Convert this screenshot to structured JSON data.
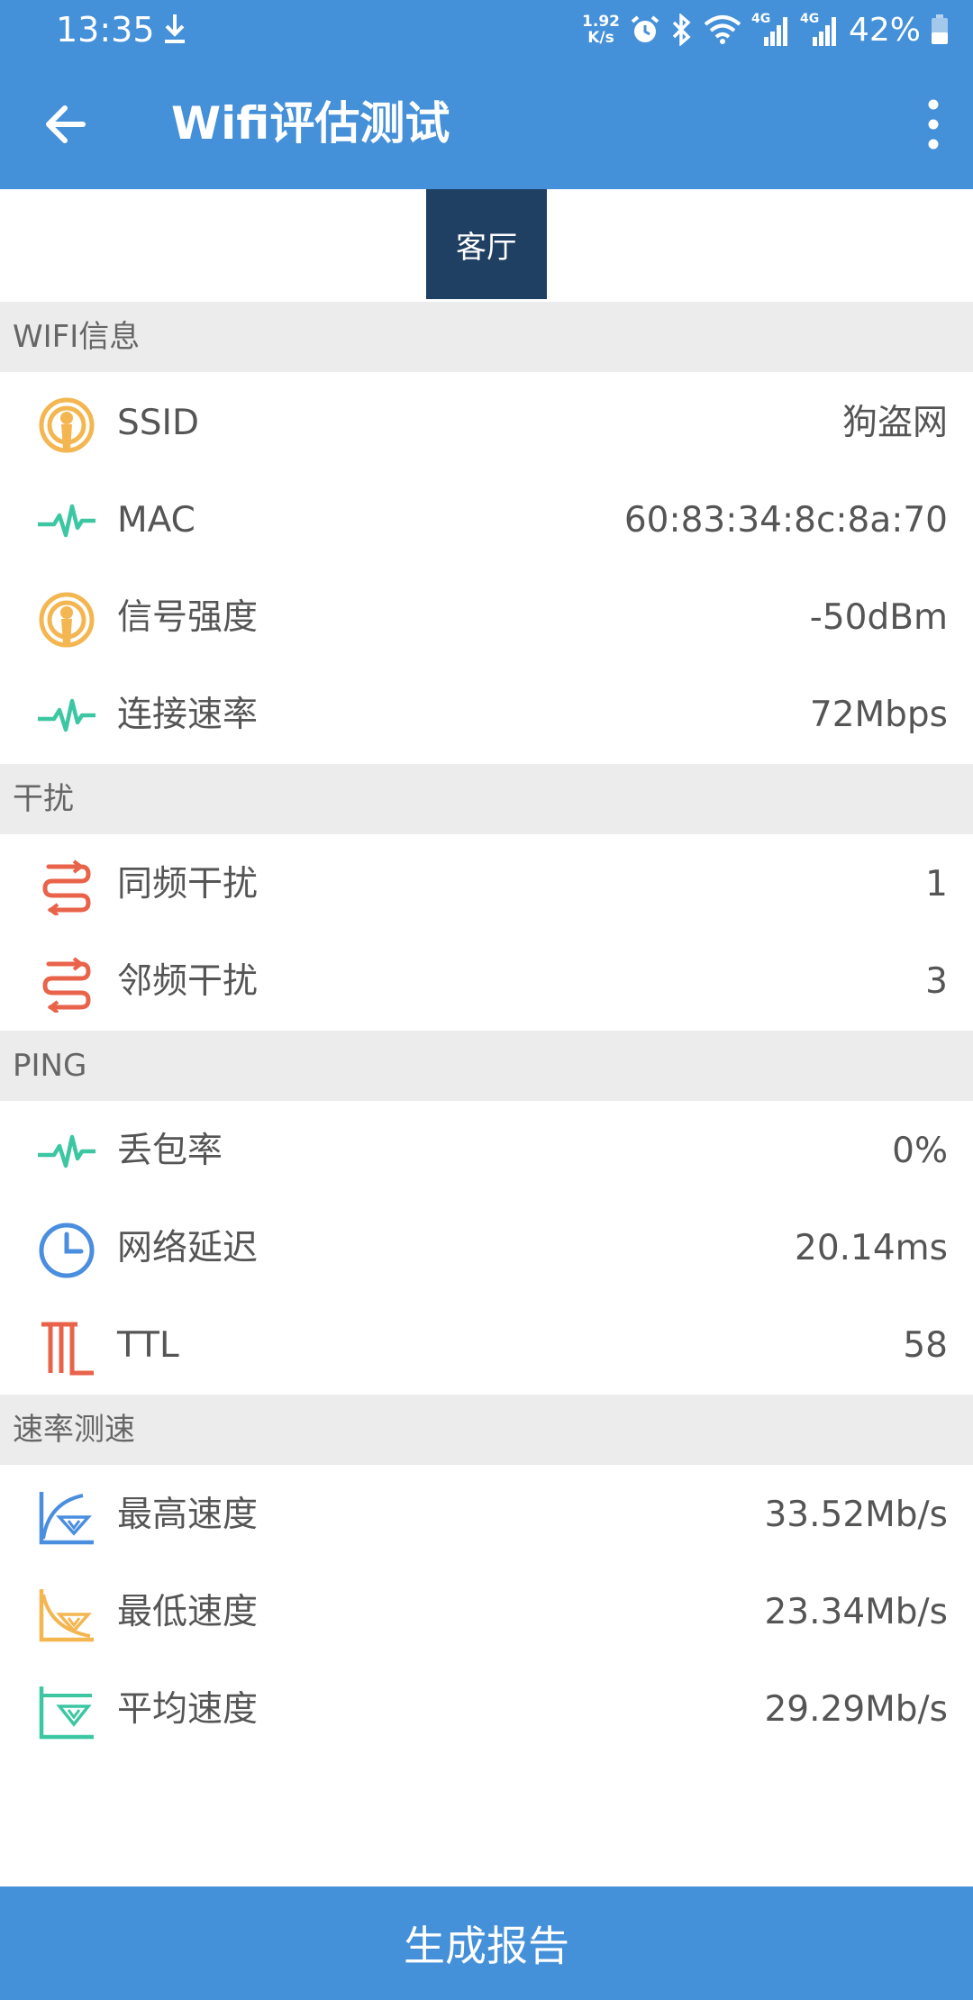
{
  "status": {
    "time": "13:35",
    "net_speed_value": "1.92",
    "net_speed_unit": "K/s",
    "net_type_1": "4G",
    "net_type_2": "4G",
    "battery": "42%"
  },
  "appbar": {
    "title": "Wifi评估测试"
  },
  "tabs": [
    "客厅"
  ],
  "sections": {
    "wifi": "WIFI信息",
    "interference": "干扰",
    "ping": "PING",
    "speed": "速率测速"
  },
  "wifi": [
    {
      "label": "SSID",
      "value": "狗盗网",
      "icon": "broadcast-icon"
    },
    {
      "label": "MAC",
      "value": "60:83:34:8c:8a:70",
      "icon": "pulse-icon"
    },
    {
      "label": "信号强度",
      "value": "-50dBm",
      "icon": "broadcast-icon"
    },
    {
      "label": "连接速率",
      "value": "72Mbps",
      "icon": "pulse-icon"
    }
  ],
  "interference": [
    {
      "label": "同频干扰",
      "value": "1",
      "icon": "interference-icon"
    },
    {
      "label": "邻频干扰",
      "value": "3",
      "icon": "interference-icon"
    }
  ],
  "ping": [
    {
      "label": "丢包率",
      "value": "0%",
      "icon": "pulse-icon"
    },
    {
      "label": "网络延迟",
      "value": "20.14ms",
      "icon": "clock-icon"
    },
    {
      "label": "TTL",
      "value": "58",
      "icon": "ttl-icon"
    }
  ],
  "speed": [
    {
      "label": "最高速度",
      "value": "33.52Mb/s",
      "icon": "speed-max-icon"
    },
    {
      "label": "最低速度",
      "value": "23.34Mb/s",
      "icon": "speed-min-icon"
    },
    {
      "label": "平均速度",
      "value": "29.29Mb/s",
      "icon": "speed-avg-icon"
    }
  ],
  "colors": {
    "primary": "#4490d9",
    "tab_active": "#1f3f63",
    "orange": "#f4b650",
    "teal": "#3cc7a2",
    "red": "#e9634a",
    "blue": "#4a8ee0"
  },
  "actions": {
    "generate_report": "生成报告"
  }
}
